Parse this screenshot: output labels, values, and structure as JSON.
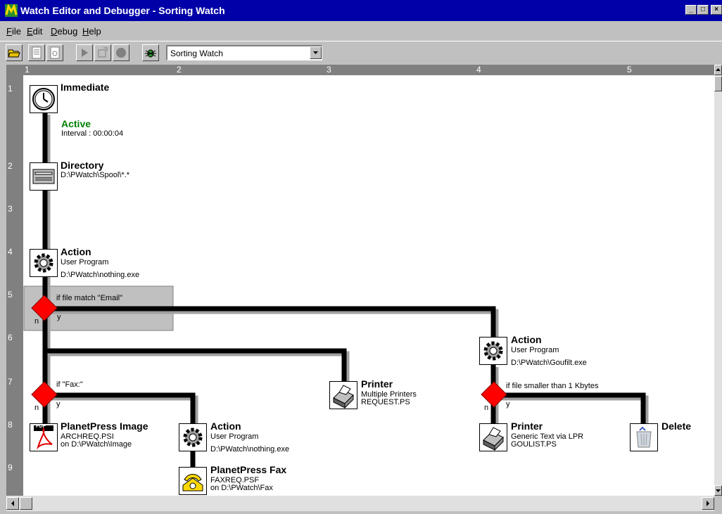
{
  "window": {
    "title": "Watch Editor and Debugger - Sorting Watch"
  },
  "menu": [
    {
      "key": "F",
      "rest": "ile"
    },
    {
      "key": "E",
      "rest": "dit"
    },
    {
      "key": "D",
      "rest": "ebug"
    },
    {
      "key": "H",
      "rest": "elp"
    }
  ],
  "toolbar": {
    "watch_select": "Sorting Watch"
  },
  "ruler": {
    "columns": [
      "1",
      "2",
      "3",
      "4",
      "5"
    ],
    "rows": [
      "1",
      "2",
      "3",
      "4",
      "5",
      "6",
      "7",
      "8",
      "9"
    ]
  },
  "nodes": {
    "immediate": {
      "title": "Immediate",
      "status": "Active",
      "interval": "Interval : 00:00:04"
    },
    "directory": {
      "title": "Directory",
      "path": "D:\\PWatch\\Spool\\*.*"
    },
    "action1": {
      "title": "Action",
      "line1": "User Program",
      "line2": "D:\\PWatch\\nothing.exe"
    },
    "cond_email": {
      "label": "if file match \"Email\"",
      "no": "n",
      "yes": "y"
    },
    "printer1": {
      "title": "Printer",
      "line1": "Multiple Printers",
      "line2": "REQUEST.PS"
    },
    "action_goufilt": {
      "title": "Action",
      "line1": "User Program",
      "line2": "D:\\PWatch\\Goufilt.exe"
    },
    "cond_fax": {
      "label": "if \"Fax:\"",
      "no": "n",
      "yes": "y"
    },
    "cond_small": {
      "label": "if file smaller than 1 Kbytes",
      "no": "n",
      "yes": "y"
    },
    "pp_image": {
      "title": "PlanetPress Image",
      "line1": "ARCHREQ.PSI",
      "line2": "on D:\\PWatch\\Image",
      "badge": "PDF"
    },
    "action2": {
      "title": "Action",
      "line1": "User Program",
      "line2": "D:\\PWatch\\nothing.exe"
    },
    "pp_fax": {
      "title": "PlanetPress Fax",
      "line1": "FAXREQ.PSF",
      "line2": "on D:\\PWatch\\Fax"
    },
    "printer2": {
      "title": "Printer",
      "line1": "Generic Text via LPR",
      "line2": "GOULIST.PS"
    },
    "delete": {
      "title": "Delete"
    }
  }
}
